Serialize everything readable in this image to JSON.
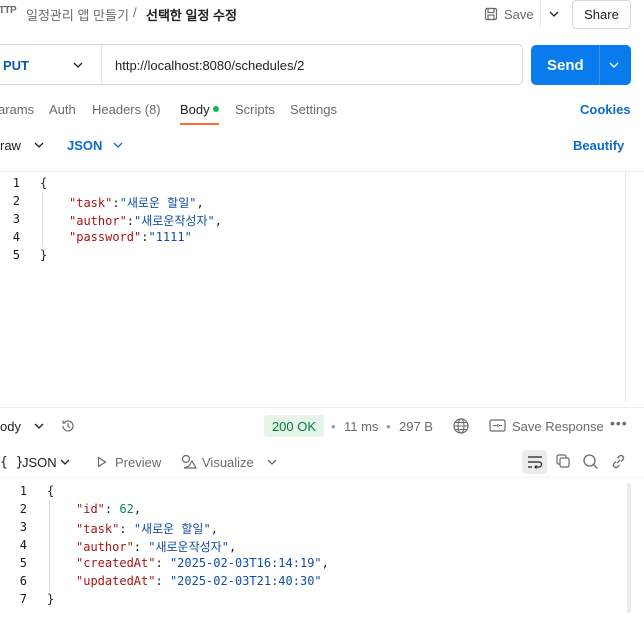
{
  "header": {
    "app_icon_text": "HTTP",
    "breadcrumb_parent": "일정관리 앱 만들기",
    "breadcrumb_sep": "/",
    "breadcrumb_current": "선택한 일정 수정",
    "save_label": "Save",
    "share_label": "Share"
  },
  "request": {
    "method": "PUT",
    "url": "http://localhost:8080/schedules/2",
    "send_label": "Send"
  },
  "tabs": {
    "params": "arams",
    "auth": "Auth",
    "headers": "Headers (8)",
    "body": "Body",
    "scripts": "Scripts",
    "settings": "Settings",
    "cookies": "Cookies"
  },
  "body_options": {
    "mode": "raw",
    "format": "JSON",
    "beautify": "Beautify"
  },
  "request_body": {
    "line_numbers": [
      "1",
      "2",
      "3",
      "4",
      "5"
    ],
    "open_brace": "{",
    "close_brace": "}",
    "task_key": "\"task\"",
    "task_val": "\"새로운 할일\"",
    "author_key": "\"author\"",
    "author_val": "\"새로운작성자\"",
    "password_key": "\"password\"",
    "password_val": "\"1111\"",
    "colon": ":",
    "comma": ","
  },
  "response": {
    "body_label": "ody",
    "status": "200 OK",
    "time": "11 ms",
    "size": "297 B",
    "dot": "•",
    "save_response": "Save Response",
    "more": "•••",
    "format": "JSON",
    "format_icon": "{ }",
    "preview": "Preview",
    "visualize": "Visualize"
  },
  "response_body": {
    "line_numbers": [
      "1",
      "2",
      "3",
      "4",
      "5",
      "6",
      "7"
    ],
    "open_brace": "{",
    "close_brace": "}",
    "id_key": "\"id\"",
    "id_val": "62",
    "task_key": "\"task\"",
    "task_val": "\"새로운 할일\"",
    "author_key": "\"author\"",
    "author_val": "\"새로운작성자\"",
    "created_key": "\"createdAt\"",
    "created_val": "\"2025-02-03T16:14:19\"",
    "updated_key": "\"updatedAt\"",
    "updated_val": "\"2025-02-03T21:40:30\"",
    "colon_sp": ": ",
    "comma": ","
  },
  "colors": {
    "accent_send": "#097bed",
    "tab_underline": "#ff6c37",
    "status_ok": "#007f31",
    "body_dot": "#0cbb52"
  }
}
